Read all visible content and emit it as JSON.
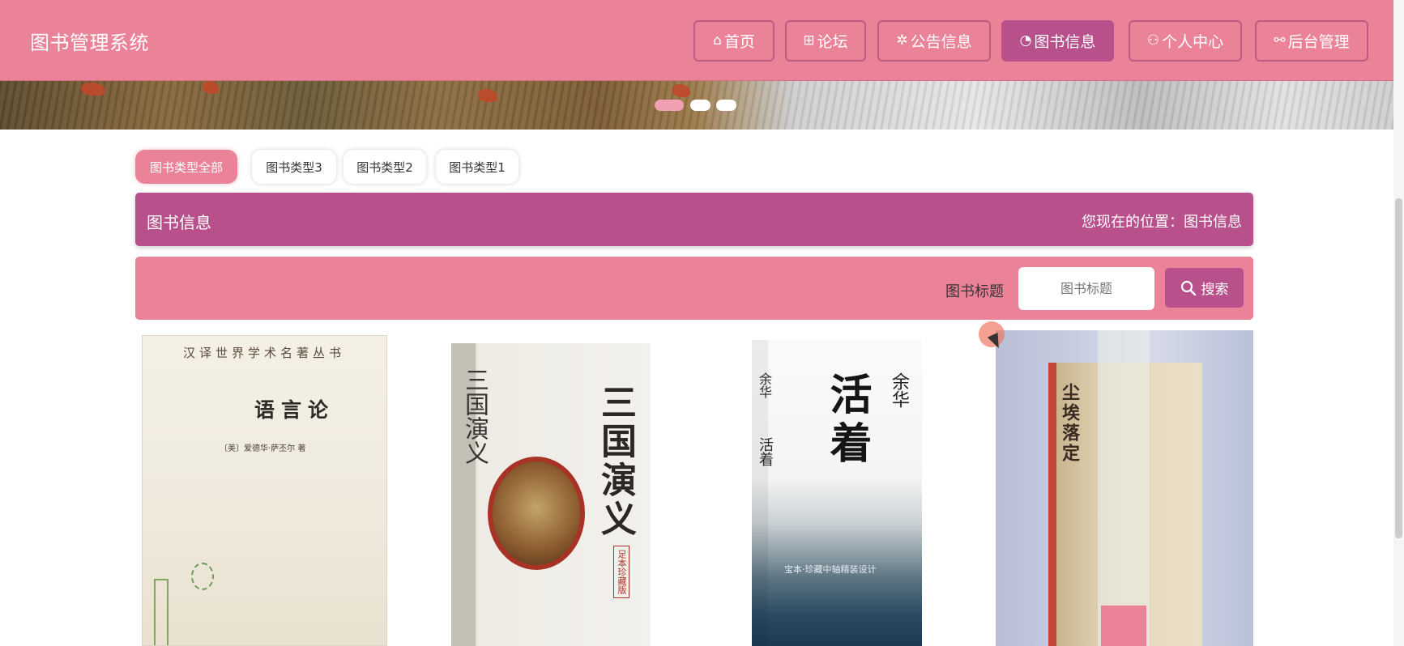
{
  "app": {
    "title": "图书管理系统"
  },
  "nav": [
    {
      "label": "首页",
      "icon": "home-icon",
      "glyph": "⌂"
    },
    {
      "label": "论坛",
      "icon": "forum-icon",
      "glyph": "⊞"
    },
    {
      "label": "公告信息",
      "icon": "announcement-icon",
      "glyph": "✲"
    },
    {
      "label": "图书信息",
      "icon": "book-info-icon",
      "glyph": "◔"
    },
    {
      "label": "个人中心",
      "icon": "user-icon",
      "glyph": "⚇"
    },
    {
      "label": "后台管理",
      "icon": "link-icon",
      "glyph": "⚯"
    }
  ],
  "nav_active_index": 3,
  "book_types": [
    {
      "label": "图书类型全部",
      "active": true
    },
    {
      "label": "图书类型3",
      "active": false
    },
    {
      "label": "图书类型2",
      "active": false
    },
    {
      "label": "图书类型1",
      "active": false
    }
  ],
  "section": {
    "title": "图书信息",
    "location": "您现在的位置：图书信息"
  },
  "search": {
    "label": "图书标题",
    "placeholder": "图书标题",
    "value": "",
    "button_label": "搜索",
    "button_icon": "search-icon"
  },
  "books": [
    {
      "series": "汉译世界学术名著丛书",
      "title": "语言论",
      "author": "〔美〕爱德华·萨丕尔 著"
    },
    {
      "title": "三国演义",
      "subtitle": "足本珍藏版"
    },
    {
      "title": "活着",
      "author": "余华",
      "footer": "宝本·珍藏中轴精装设计"
    },
    {
      "title": "尘埃落定"
    }
  ],
  "colors": {
    "primary_pink": "#ea8398",
    "accent_magenta": "#b8508c",
    "white": "#ffffff"
  }
}
